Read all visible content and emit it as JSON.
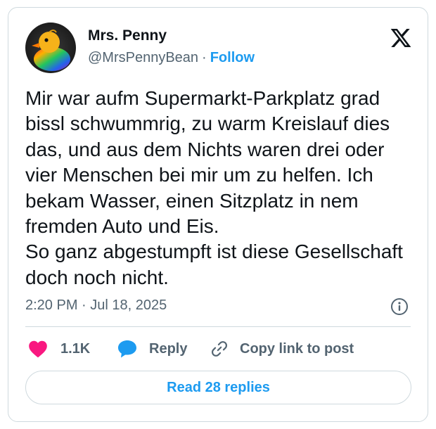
{
  "author": {
    "name": "Mrs. Penny",
    "handle": "@MrsPennyBean",
    "separator": "·",
    "follow_label": "Follow",
    "avatar_icon": "rubber-duck-avatar"
  },
  "platform_icon": "x-logo-icon",
  "tweet": {
    "text": "Mir war aufm Supermarkt-Parkplatz grad bissl schwummrig, zu warm Kreislauf dies das, und aus dem Nichts waren drei oder vier Menschen bei mir um zu helfen. Ich bekam Wasser, einen Sitzplatz in nem fremden Auto und Eis.\nSo ganz abgestumpft ist diese Gesellschaft doch noch nicht.",
    "timestamp": "2:20 PM · Jul 18, 2025",
    "info_icon": "info-icon"
  },
  "actions": {
    "like_count": "1.1K",
    "like_icon": "heart-icon",
    "reply_label": "Reply",
    "reply_icon": "speech-bubble-icon",
    "copy_label": "Copy link to post",
    "copy_icon": "link-icon"
  },
  "read_replies_label": "Read 28 replies",
  "colors": {
    "accent": "#1d9bf0",
    "like": "#f91880",
    "secondary_text": "#536471",
    "border": "#cfd9de"
  }
}
